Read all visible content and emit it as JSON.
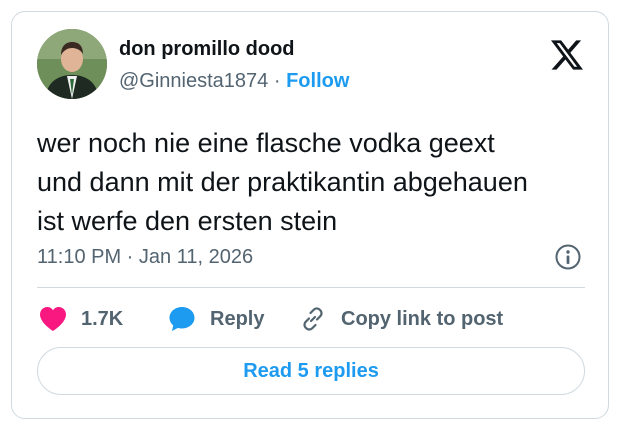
{
  "author": {
    "display_name": "don promillo dood",
    "handle": "@Ginniesta1874",
    "separator": "·",
    "follow_label": "Follow"
  },
  "tweet": {
    "lines": [
      "wer noch nie eine flasche vodka geext",
      "und dann mit der praktikantin abgehauen",
      "ist werfe den ersten stein"
    ],
    "timestamp": "11:10 PM · Jan 11, 2026"
  },
  "actions": {
    "like_count": "1.7K",
    "reply_label": "Reply",
    "copy_label": "Copy link to post"
  },
  "read_replies_label": "Read 5 replies",
  "icons": {
    "brand": "x-logo-icon",
    "info": "info-icon",
    "like": "heart-icon",
    "reply": "speech-bubble-icon",
    "copy": "link-icon"
  },
  "colors": {
    "accent": "#1d9bf0",
    "like": "#f91880",
    "text": "#0f1419",
    "muted": "#536471",
    "border": "#cfd9de"
  }
}
